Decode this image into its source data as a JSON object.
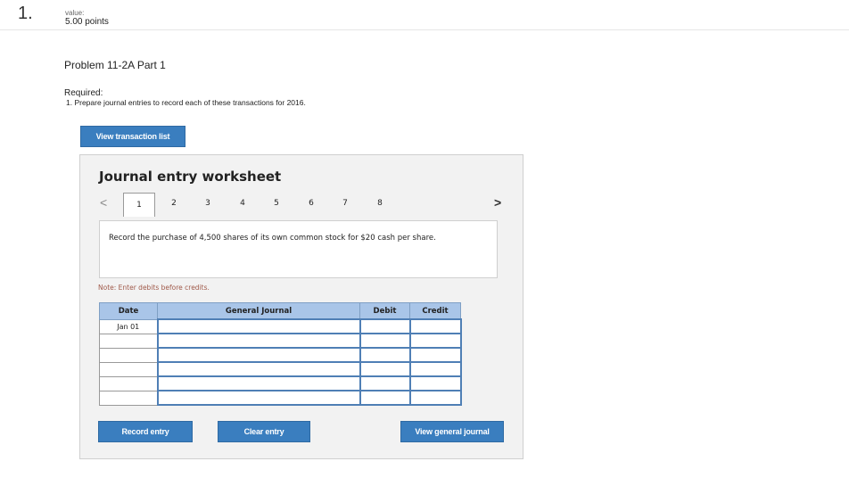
{
  "question": {
    "number": "1.",
    "value_label": "value:",
    "points": "5.00 points"
  },
  "problem": {
    "title": "Problem 11-2A Part 1",
    "required_label": "Required:",
    "required_item": "1. Prepare journal entries to record each of these transactions for 2016."
  },
  "buttons": {
    "view_transaction_list": "View transaction list",
    "record_entry": "Record entry",
    "clear_entry": "Clear entry",
    "view_general_journal": "View general journal"
  },
  "worksheet": {
    "title": "Journal entry worksheet",
    "nav_prev": "<",
    "nav_next": ">",
    "tabs": [
      "1",
      "2",
      "3",
      "4",
      "5",
      "6",
      "7",
      "8"
    ],
    "active_tab": "1",
    "description": "Record the purchase of 4,500 shares of its own common stock for $20 cash per share.",
    "note": "Note: Enter debits before credits."
  },
  "journal": {
    "headers": {
      "date": "Date",
      "general_journal": "General Journal",
      "debit": "Debit",
      "credit": "Credit"
    },
    "rows": [
      {
        "date": "Jan 01",
        "account": "",
        "debit": "",
        "credit": ""
      },
      {
        "date": "",
        "account": "",
        "debit": "",
        "credit": ""
      },
      {
        "date": "",
        "account": "",
        "debit": "",
        "credit": ""
      },
      {
        "date": "",
        "account": "",
        "debit": "",
        "credit": ""
      },
      {
        "date": "",
        "account": "",
        "debit": "",
        "credit": ""
      },
      {
        "date": "",
        "account": "",
        "debit": "",
        "credit": ""
      }
    ]
  },
  "colors": {
    "button_blue": "#3a7ebf",
    "header_blue": "#a9c5e8",
    "input_border": "#4f7fb5",
    "note_text": "#a05a4a"
  }
}
